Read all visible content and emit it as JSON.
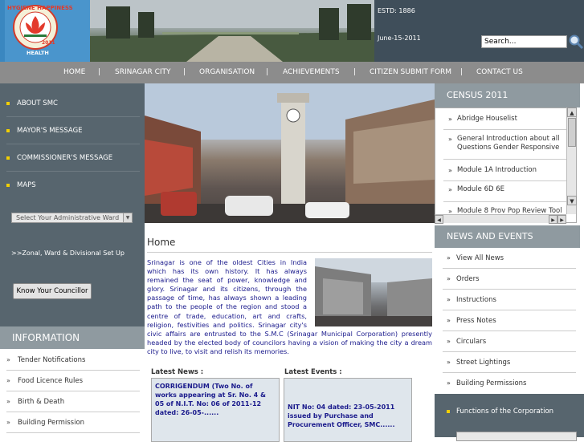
{
  "header": {
    "logo_top": "HYGIENE HAPPINESS",
    "logo_year": "2011",
    "logo_bottom": "HEALTH",
    "estd": "ESTD: 1886",
    "date": "June-15-2011",
    "search_placeholder": "Search..."
  },
  "nav": {
    "items": [
      "HOME",
      "SRINAGAR CITY",
      "ORGANISATION",
      "ACHIEVEMENTS",
      "CITIZEN SUBMIT FORM",
      "CONTACT US"
    ],
    "separator": "|"
  },
  "sidebar": {
    "items": [
      "ABOUT SMC",
      "MAYOR'S MESSAGE",
      "COMMISSIONER'S MESSAGE",
      "MAPS"
    ],
    "ward_select": "Select Your Administrative Ward",
    "zonal_link": ">>Zonal, Ward & Divisional Set Up",
    "councillor_button": "Know Your Councillor"
  },
  "information": {
    "heading": "INFORMATION",
    "items": [
      "Tender Notifications",
      "Food Licence Rules",
      "Birth & Death",
      "Building Permission"
    ]
  },
  "main": {
    "title": "Home",
    "intro": "Srinagar is one of the oldest Cities in India which has its own history. It has always remained the seat of power, knowledge and glory. Srinagar and its citizens, through the passage of time, has always shown a leading path to the people of the region and stood a centre of trade, education, art and crafts, religion, festivities and politics. Srinagar city's civic affairs are entrusted to the S.M.C (Srinagar Municipal Corporation) presently headed by the elected body of councilors having a vision of making the city a dream city to live, to visit and relish its memories.",
    "latest_news_label": "Latest News :",
    "latest_news_text": "CORRIGENDUM (Two No. of works appearing at Sr. No. 4 & 05 of N.I.T. No: 06 of 2011-12 dated: 26-05-......",
    "latest_events_label": "Latest Events :",
    "latest_events_text": "NIT No: 04 dated: 23-05-2011 issued by Purchase and Procurement Officer, SMC......"
  },
  "census": {
    "heading": "CENSUS 2011",
    "items": [
      "Abridge Houselist",
      "General Introduction about all Questions Gender Responsive",
      "Module 1A Introduction",
      "Module 6D 6E",
      "Module 8 Prov Pop Review Tool"
    ]
  },
  "news_events": {
    "heading": "NEWS AND EVENTS",
    "items": [
      "View All News",
      "Orders",
      "Instructions",
      "Press Notes",
      "Circulars",
      "Street Lightings",
      "Building Permissions"
    ]
  },
  "functions_link": "Functions of the Corporation",
  "bullet": "»"
}
